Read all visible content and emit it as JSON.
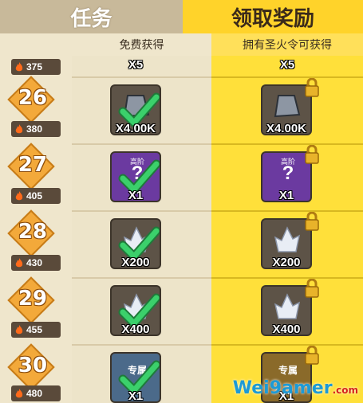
{
  "tabs": {
    "left": "任务",
    "right": "领取奖励"
  },
  "headers": {
    "free": "免费获得",
    "premium": "拥有圣火令可获得"
  },
  "rows": [
    {
      "level": "",
      "points": "375",
      "free_qty": "X5",
      "premium_qty": "X5",
      "item": "partial"
    },
    {
      "level": "26",
      "points": "380",
      "free_qty": "X4.00K",
      "premium_qty": "X4.00K",
      "item": "stone"
    },
    {
      "level": "27",
      "points": "405",
      "free_qty": "X1",
      "premium_qty": "X1",
      "item": "mystery"
    },
    {
      "level": "28",
      "points": "430",
      "free_qty": "X200",
      "premium_qty": "X200",
      "item": "crystal"
    },
    {
      "level": "29",
      "points": "455",
      "free_qty": "X400",
      "premium_qty": "X400",
      "item": "crystal"
    },
    {
      "level": "30",
      "points": "480",
      "free_qty": "X1",
      "premium_qty": "X1",
      "item": "exclusive"
    }
  ],
  "item_labels": {
    "mystery": "高阶",
    "exclusive": "专属"
  },
  "watermark": {
    "text": "Wei9amer",
    "sub": ".com"
  },
  "colors": {
    "premium_bg": "#ffe03a",
    "tab_active": "#ffd32a",
    "check": "#3bd06b",
    "fire_badge": "#5a4a3a"
  },
  "icons": {
    "check": "checkmark-icon",
    "lock": "lock-icon",
    "fire": "fire-icon"
  }
}
